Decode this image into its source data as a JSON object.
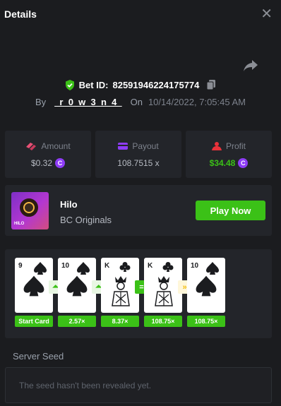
{
  "header": {
    "title": "Details",
    "close_icon": "close-icon"
  },
  "share": {
    "icon": "share-icon"
  },
  "bet": {
    "label": "Bet ID:",
    "id": "82591946224175774",
    "by_label": "By",
    "user": "_r_0_w_3_n_4_",
    "on_label": "On",
    "date": "10/14/2022, 7:05:45 AM"
  },
  "stats": {
    "amount": {
      "label": "Amount",
      "value": "$0.32"
    },
    "payout": {
      "label": "Payout",
      "value": "108.7515 x"
    },
    "profit": {
      "label": "Profit",
      "value": "$34.48"
    }
  },
  "game": {
    "name": "Hilo",
    "provider": "BC Originals",
    "thumb_text": "HILO",
    "play_label": "Play Now"
  },
  "cards": [
    {
      "rank": "9",
      "suit": "spade",
      "label": "Start Card"
    },
    {
      "rank": "10",
      "suit": "spade",
      "label": "2.57×",
      "action": "up"
    },
    {
      "rank": "K",
      "suit": "club",
      "label": "8.37×",
      "action": "up"
    },
    {
      "rank": "K",
      "suit": "club",
      "label": "108.75×",
      "action": "equal"
    },
    {
      "rank": "10",
      "suit": "spade",
      "label": "108.75×",
      "action": "skip"
    }
  ],
  "arrows": [
    "⏶",
    "⏶",
    "=",
    "»"
  ],
  "seed": {
    "label": "Server Seed",
    "placeholder": "The seed hasn't been revealed yet."
  },
  "colors": {
    "accent_green": "#3bc117",
    "coin_purple": "#8e3cf6",
    "background": "#1b1c1f",
    "panel": "#23252a"
  }
}
